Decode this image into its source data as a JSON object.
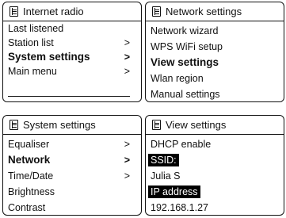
{
  "panels": {
    "internet_radio": {
      "title": "Internet radio",
      "items": [
        {
          "label": "Last listened",
          "arrow": ""
        },
        {
          "label": "Station list",
          "arrow": ">"
        },
        {
          "label": "System settings",
          "arrow": ">"
        },
        {
          "label": "Main menu",
          "arrow": ">"
        }
      ]
    },
    "network_settings": {
      "title": "Network settings",
      "items": [
        {
          "label": "Network wizard"
        },
        {
          "label": "WPS WiFi setup"
        },
        {
          "label": "View settings"
        },
        {
          "label": "Wlan region"
        },
        {
          "label": "Manual settings"
        }
      ]
    },
    "system_settings": {
      "title": "System settings",
      "items": [
        {
          "label": "Equaliser",
          "arrow": ">"
        },
        {
          "label": "Network",
          "arrow": ">"
        },
        {
          "label": "Time/Date",
          "arrow": ">"
        },
        {
          "label": "Brightness",
          "arrow": ""
        },
        {
          "label": "Contrast",
          "arrow": ""
        }
      ]
    },
    "view_settings": {
      "title": "View settings",
      "items": [
        {
          "label": "DHCP enable"
        },
        {
          "label": "SSID:"
        },
        {
          "label": "Julia S"
        },
        {
          "label": "IP address"
        },
        {
          "label": "192.168.1.27"
        }
      ]
    }
  }
}
